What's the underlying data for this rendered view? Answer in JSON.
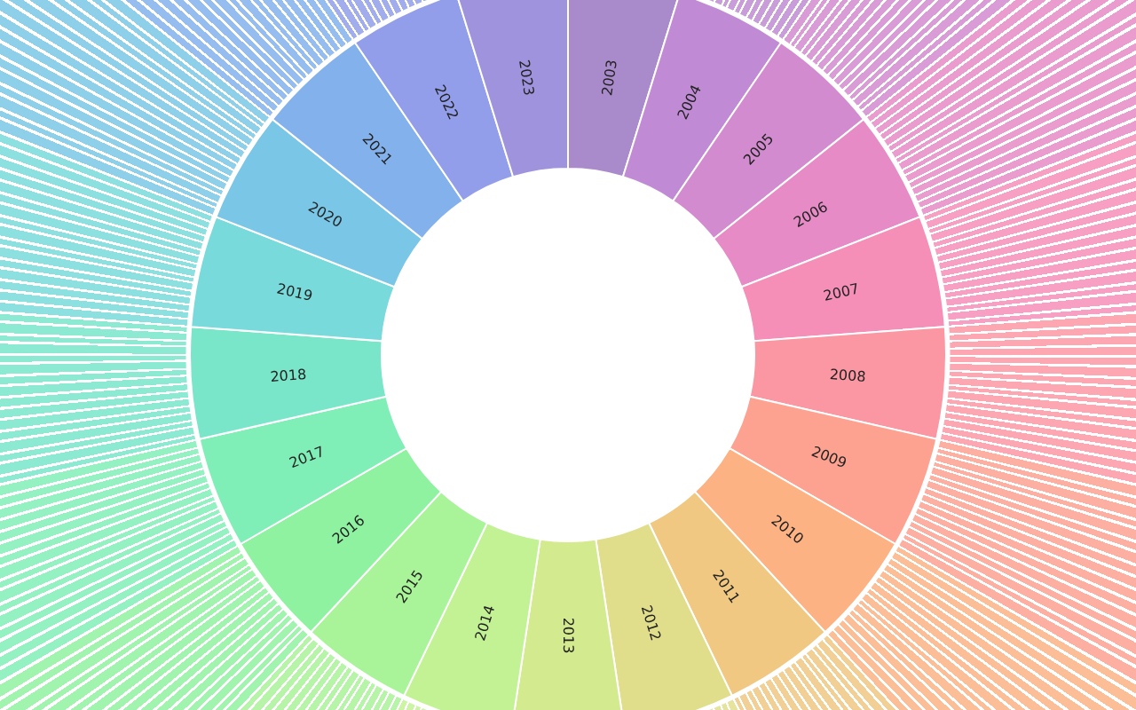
{
  "chart": {
    "years": [
      {
        "label": "2003",
        "color": "#a98bcc"
      },
      {
        "label": "2004",
        "color": "#c08bd4"
      },
      {
        "label": "2005",
        "color": "#d38bd0"
      },
      {
        "label": "2006",
        "color": "#e68bc6"
      },
      {
        "label": "2007",
        "color": "#f58fb8"
      },
      {
        "label": "2008",
        "color": "#fb97a3"
      },
      {
        "label": "2009",
        "color": "#fda290"
      },
      {
        "label": "2010",
        "color": "#fcb283"
      },
      {
        "label": "2011",
        "color": "#f0c882"
      },
      {
        "label": "2012",
        "color": "#e0de8a"
      },
      {
        "label": "2013",
        "color": "#d4ea8e"
      },
      {
        "label": "2014",
        "color": "#c2f293"
      },
      {
        "label": "2015",
        "color": "#a9f398"
      },
      {
        "label": "2016",
        "color": "#8ff2a0"
      },
      {
        "label": "2017",
        "color": "#80eeb7"
      },
      {
        "label": "2018",
        "color": "#79e6ca"
      },
      {
        "label": "2019",
        "color": "#78dadb"
      },
      {
        "label": "2020",
        "color": "#7ac6e6"
      },
      {
        "label": "2021",
        "color": "#83b1ec"
      },
      {
        "label": "2022",
        "color": "#929eea"
      },
      {
        "label": "2023",
        "color": "#9f93dd"
      }
    ]
  }
}
